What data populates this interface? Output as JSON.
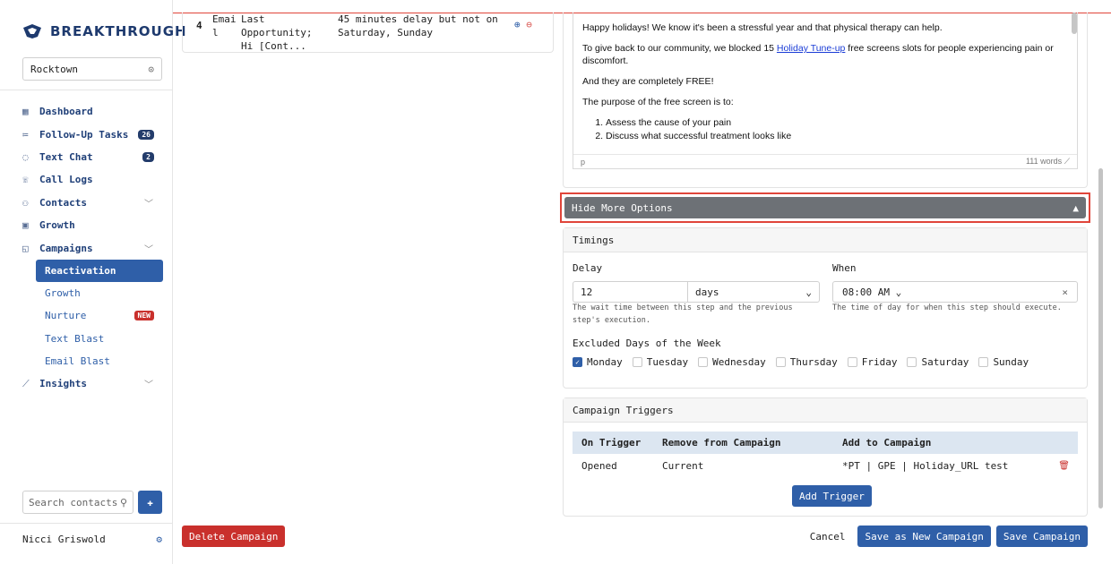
{
  "brand": {
    "name": "BREAKTHROUGH",
    "accent": "#1e3a6e"
  },
  "sidebar": {
    "location": "Rocktown",
    "nav": [
      {
        "label": "Dashboard",
        "icon": "dashboard-icon"
      },
      {
        "label": "Follow-Up Tasks",
        "icon": "list-icon",
        "badge": "26"
      },
      {
        "label": "Text Chat",
        "icon": "chat-icon",
        "badge": "2"
      },
      {
        "label": "Call Logs",
        "icon": "phone-icon"
      },
      {
        "label": "Contacts",
        "icon": "people-icon",
        "chevron": true
      },
      {
        "label": "Growth",
        "icon": "growth-icon"
      },
      {
        "label": "Campaigns",
        "icon": "campaign-icon",
        "chevron": true
      }
    ],
    "sub": [
      {
        "label": "Reactivation",
        "active": true
      },
      {
        "label": "Growth"
      },
      {
        "label": "Nurture",
        "badge": "NEW"
      },
      {
        "label": "Text Blast"
      },
      {
        "label": "Email Blast"
      }
    ],
    "insights": "Insights",
    "search_placeholder": "Search contacts",
    "user": "Nicci Griswold"
  },
  "step_row": {
    "number": "4",
    "type_line1": "Emai",
    "type_line2": "l",
    "subject_line1": "Last Opportunity;",
    "subject_line2": "Hi [Cont...",
    "delay_line1": "45 minutes delay but not on",
    "delay_line2": "Saturday, Sunday"
  },
  "delete_label": "Delete Campaign",
  "editor": {
    "p1": "Happy holidays! We know it's been a stressful year and that physical therapy can help.",
    "p2_before": "To give back to our community, we blocked 15 ",
    "p2_link": "Holiday Tune-up",
    "p2_after": " free screens slots for people experiencing pain or discomfort.",
    "p3": "And they are completely FREE!",
    "p4": "The purpose of the free screen is to:",
    "li1": "Assess the cause of your pain",
    "li2": "Discuss what successful treatment looks like",
    "status_left": "p",
    "word_count": "111 words"
  },
  "options_toggle": "Hide More Options",
  "timings": {
    "title": "Timings",
    "delay_label": "Delay",
    "delay_value": "12",
    "delay_unit": "days",
    "delay_hint": "The wait time between this step and the previous step's execution.",
    "when_label": "When",
    "when_value": "08:00  AM",
    "when_hint": "The time of day for when this step should execute.",
    "excluded_label": "Excluded Days of the Week",
    "days": [
      {
        "label": "Monday",
        "checked": true
      },
      {
        "label": "Tuesday",
        "checked": false
      },
      {
        "label": "Wednesday",
        "checked": false
      },
      {
        "label": "Thursday",
        "checked": false
      },
      {
        "label": "Friday",
        "checked": false
      },
      {
        "label": "Saturday",
        "checked": false
      },
      {
        "label": "Sunday",
        "checked": false
      }
    ]
  },
  "triggers": {
    "title": "Campaign Triggers",
    "headers": [
      "On Trigger",
      "Remove from Campaign",
      "Add to Campaign"
    ],
    "rows": [
      {
        "on": "Opened",
        "remove": "Current",
        "add": "*PT | GPE | Holiday_URL test"
      }
    ],
    "add_label": "Add Trigger"
  },
  "footer": {
    "cancel": "Cancel",
    "save_new": "Save as New Campaign",
    "save": "Save Campaign"
  }
}
